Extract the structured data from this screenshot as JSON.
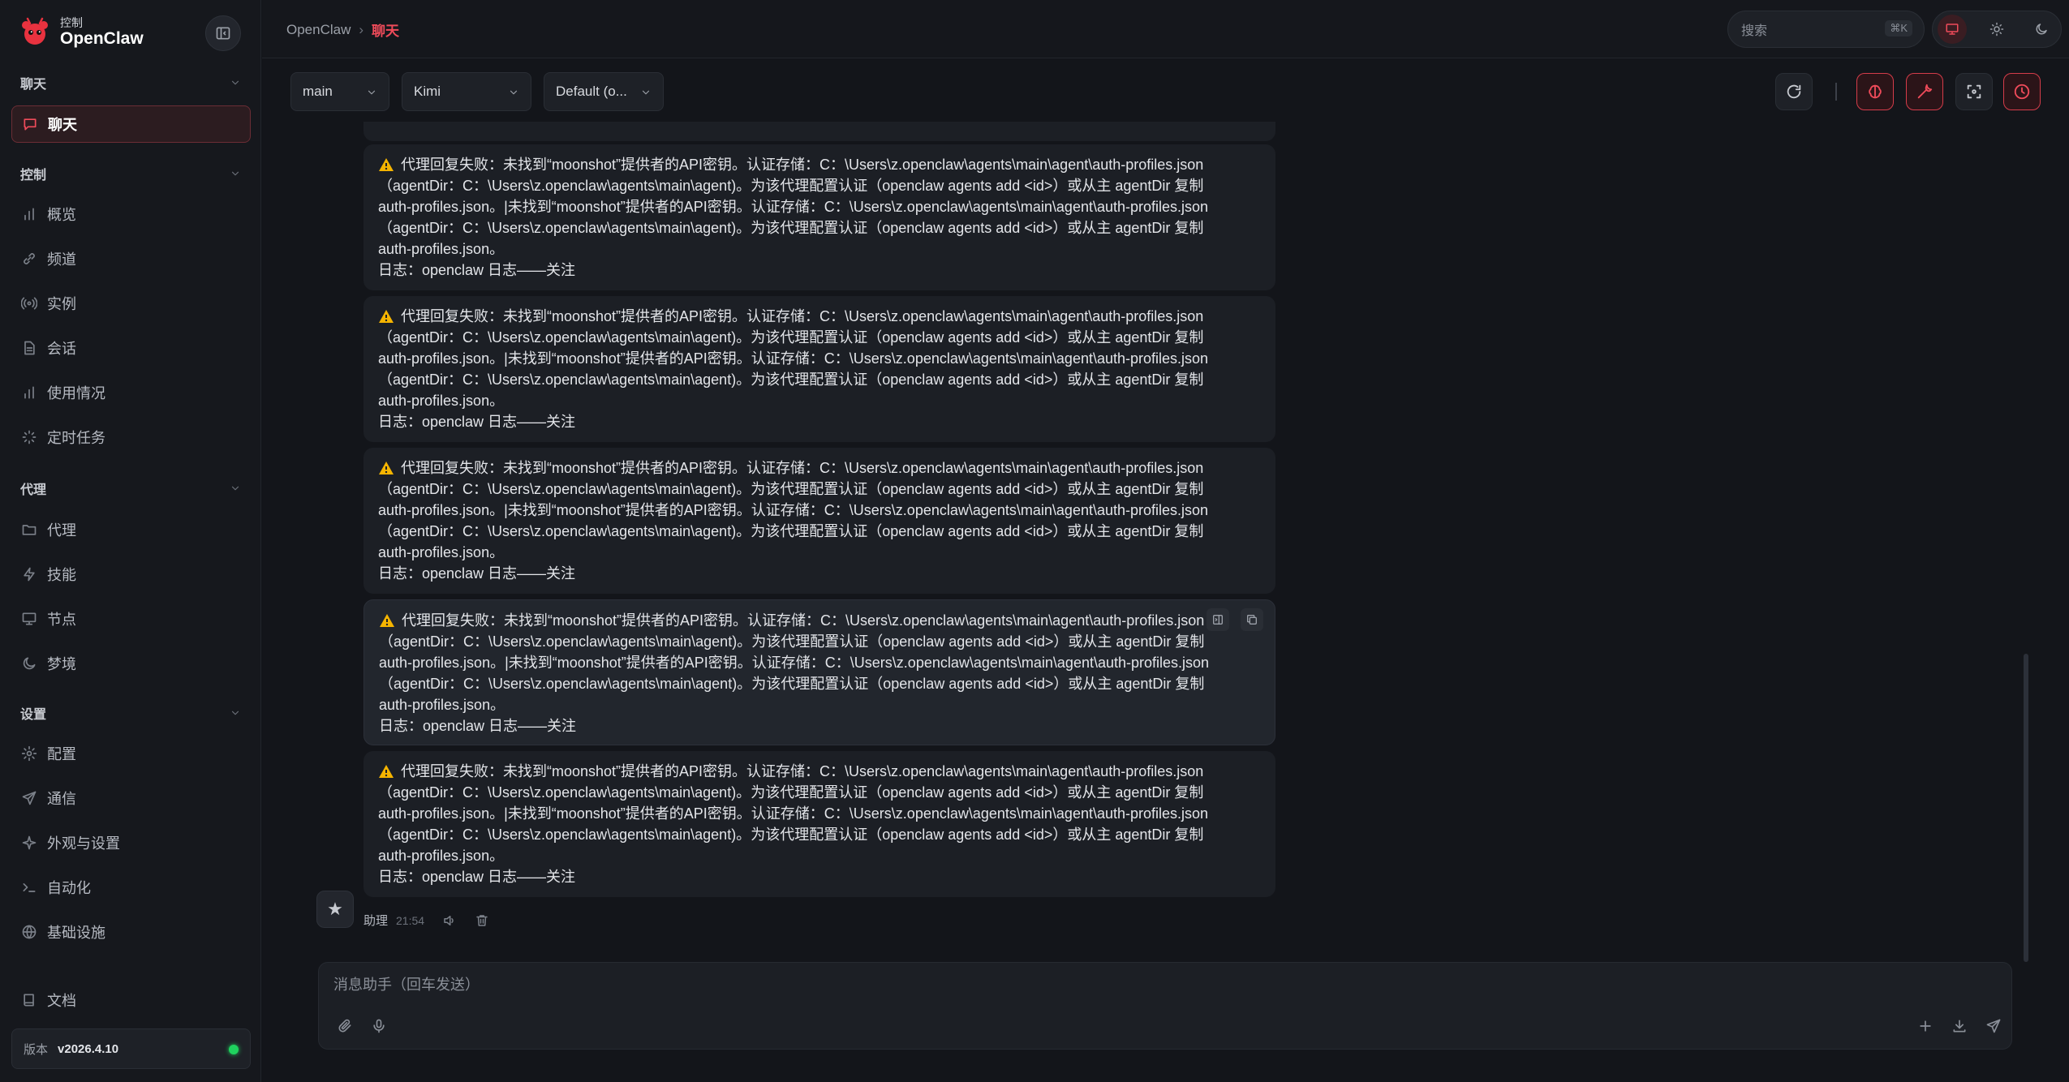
{
  "brand": {
    "subtitle": "控制",
    "name": "OpenClaw",
    "logo_icon": "lobster-icon"
  },
  "colors": {
    "accent": "#ef4b5a",
    "status_online": "#1fd35e",
    "background": "#13151a"
  },
  "sidebar": {
    "sections": [
      {
        "label": "聊天",
        "items": [
          {
            "label": "聊天",
            "icon": "chat-icon",
            "active": true
          }
        ]
      },
      {
        "label": "控制",
        "items": [
          {
            "label": "概览",
            "icon": "bar-chart-icon"
          },
          {
            "label": "频道",
            "icon": "link-icon"
          },
          {
            "label": "实例",
            "icon": "broadcast-icon"
          },
          {
            "label": "会话",
            "icon": "document-icon"
          },
          {
            "label": "使用情况",
            "icon": "bar-chart-icon"
          },
          {
            "label": "定时任务",
            "icon": "loader-icon"
          }
        ]
      },
      {
        "label": "代理",
        "items": [
          {
            "label": "代理",
            "icon": "folder-icon"
          },
          {
            "label": "技能",
            "icon": "lightning-icon"
          },
          {
            "label": "节点",
            "icon": "monitor-icon"
          },
          {
            "label": "梦境",
            "icon": "moon-icon"
          }
        ]
      },
      {
        "label": "设置",
        "items": [
          {
            "label": "配置",
            "icon": "gear-icon"
          },
          {
            "label": "通信",
            "icon": "send-icon"
          },
          {
            "label": "外观与设置",
            "icon": "sparkle-icon"
          },
          {
            "label": "自动化",
            "icon": "terminal-icon"
          },
          {
            "label": "基础设施",
            "icon": "globe-icon"
          }
        ]
      }
    ],
    "docs_label": "文档",
    "version_label": "版本",
    "version_value": "v2026.4.10"
  },
  "header": {
    "breadcrumb": [
      "OpenClaw",
      "聊天"
    ],
    "breadcrumb_sep": "›",
    "search_label": "搜索",
    "search_shortcut": "⌘K"
  },
  "toolbar": {
    "agent_select": "main",
    "model_select": "Kimi",
    "profile_select": "Default (o..."
  },
  "messages": [
    {
      "lines": [
        "代理回复失败：未找到“moonshot”提供者的API密钥。认证存储：C：\\Users\\z.openclaw\\agents\\main\\agent\\auth-profiles.json",
        "（agentDir：C：\\Users\\z.openclaw\\agents\\main\\agent)。为该代理配置认证（openclaw agents add <id>）或从主 agentDir 复制",
        "auth-profiles.json。|未找到“moonshot”提供者的API密钥。认证存储：C：\\Users\\z.openclaw\\agents\\main\\agent\\auth-profiles.json",
        "（agentDir：C：\\Users\\z.openclaw\\agents\\main\\agent)。为该代理配置认证（openclaw agents add <id>）或从主 agentDir 复制",
        "auth-profiles.json。",
        "日志：openclaw 日志——关注"
      ]
    }
  ],
  "assistant": {
    "name": "助理",
    "time": "21:54"
  },
  "composer": {
    "placeholder": "消息助手（回车发送）"
  }
}
